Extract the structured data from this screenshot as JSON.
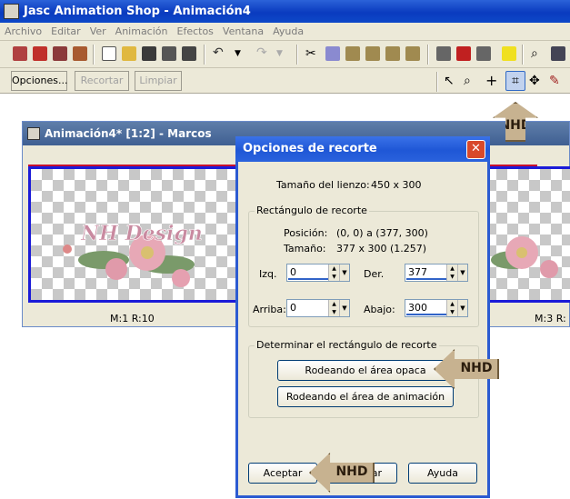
{
  "app": {
    "title": "Jasc Animation Shop - Animación4",
    "menus": [
      "Archivo",
      "Editar",
      "Ver",
      "Animación",
      "Efectos",
      "Ventana",
      "Ayuda"
    ]
  },
  "toolbar2": {
    "opciones": "Opciones...",
    "recortar": "Recortar",
    "limpiar": "Limpiar"
  },
  "anim_window": {
    "title": "Animación4* [1:2] - Marcos",
    "frame1_label": "M:1   R:10",
    "frame3_label": "M:3   R:"
  },
  "dialog": {
    "title": "Opciones de recorte",
    "canvas_label": "Tamaño del lienzo:",
    "canvas_value": "450 x 300",
    "rect_group": "Rectángulo de recorte",
    "position_label": "Posición:",
    "position_value": "(0, 0) a (377, 300)",
    "size_label": "Tamaño:",
    "size_value": "377 x 300  (1.257)",
    "izq_label": "Izq.",
    "izq_value": "0",
    "der_label": "Der.",
    "der_value": "377",
    "arriba_label": "Arriba:",
    "arriba_value": "0",
    "abajo_label": "Abajo:",
    "abajo_value": "300",
    "determine_group": "Determinar el rectángulo de recorte",
    "btn_opaque": "Rodeando el área opaca",
    "btn_anim": "Rodeando el área de animación",
    "btn_accept": "Aceptar",
    "btn_cancel_visible": "lar",
    "btn_help": "Ayuda"
  },
  "watermark": {
    "nhd": "NHD",
    "design_text": "NH Design"
  }
}
